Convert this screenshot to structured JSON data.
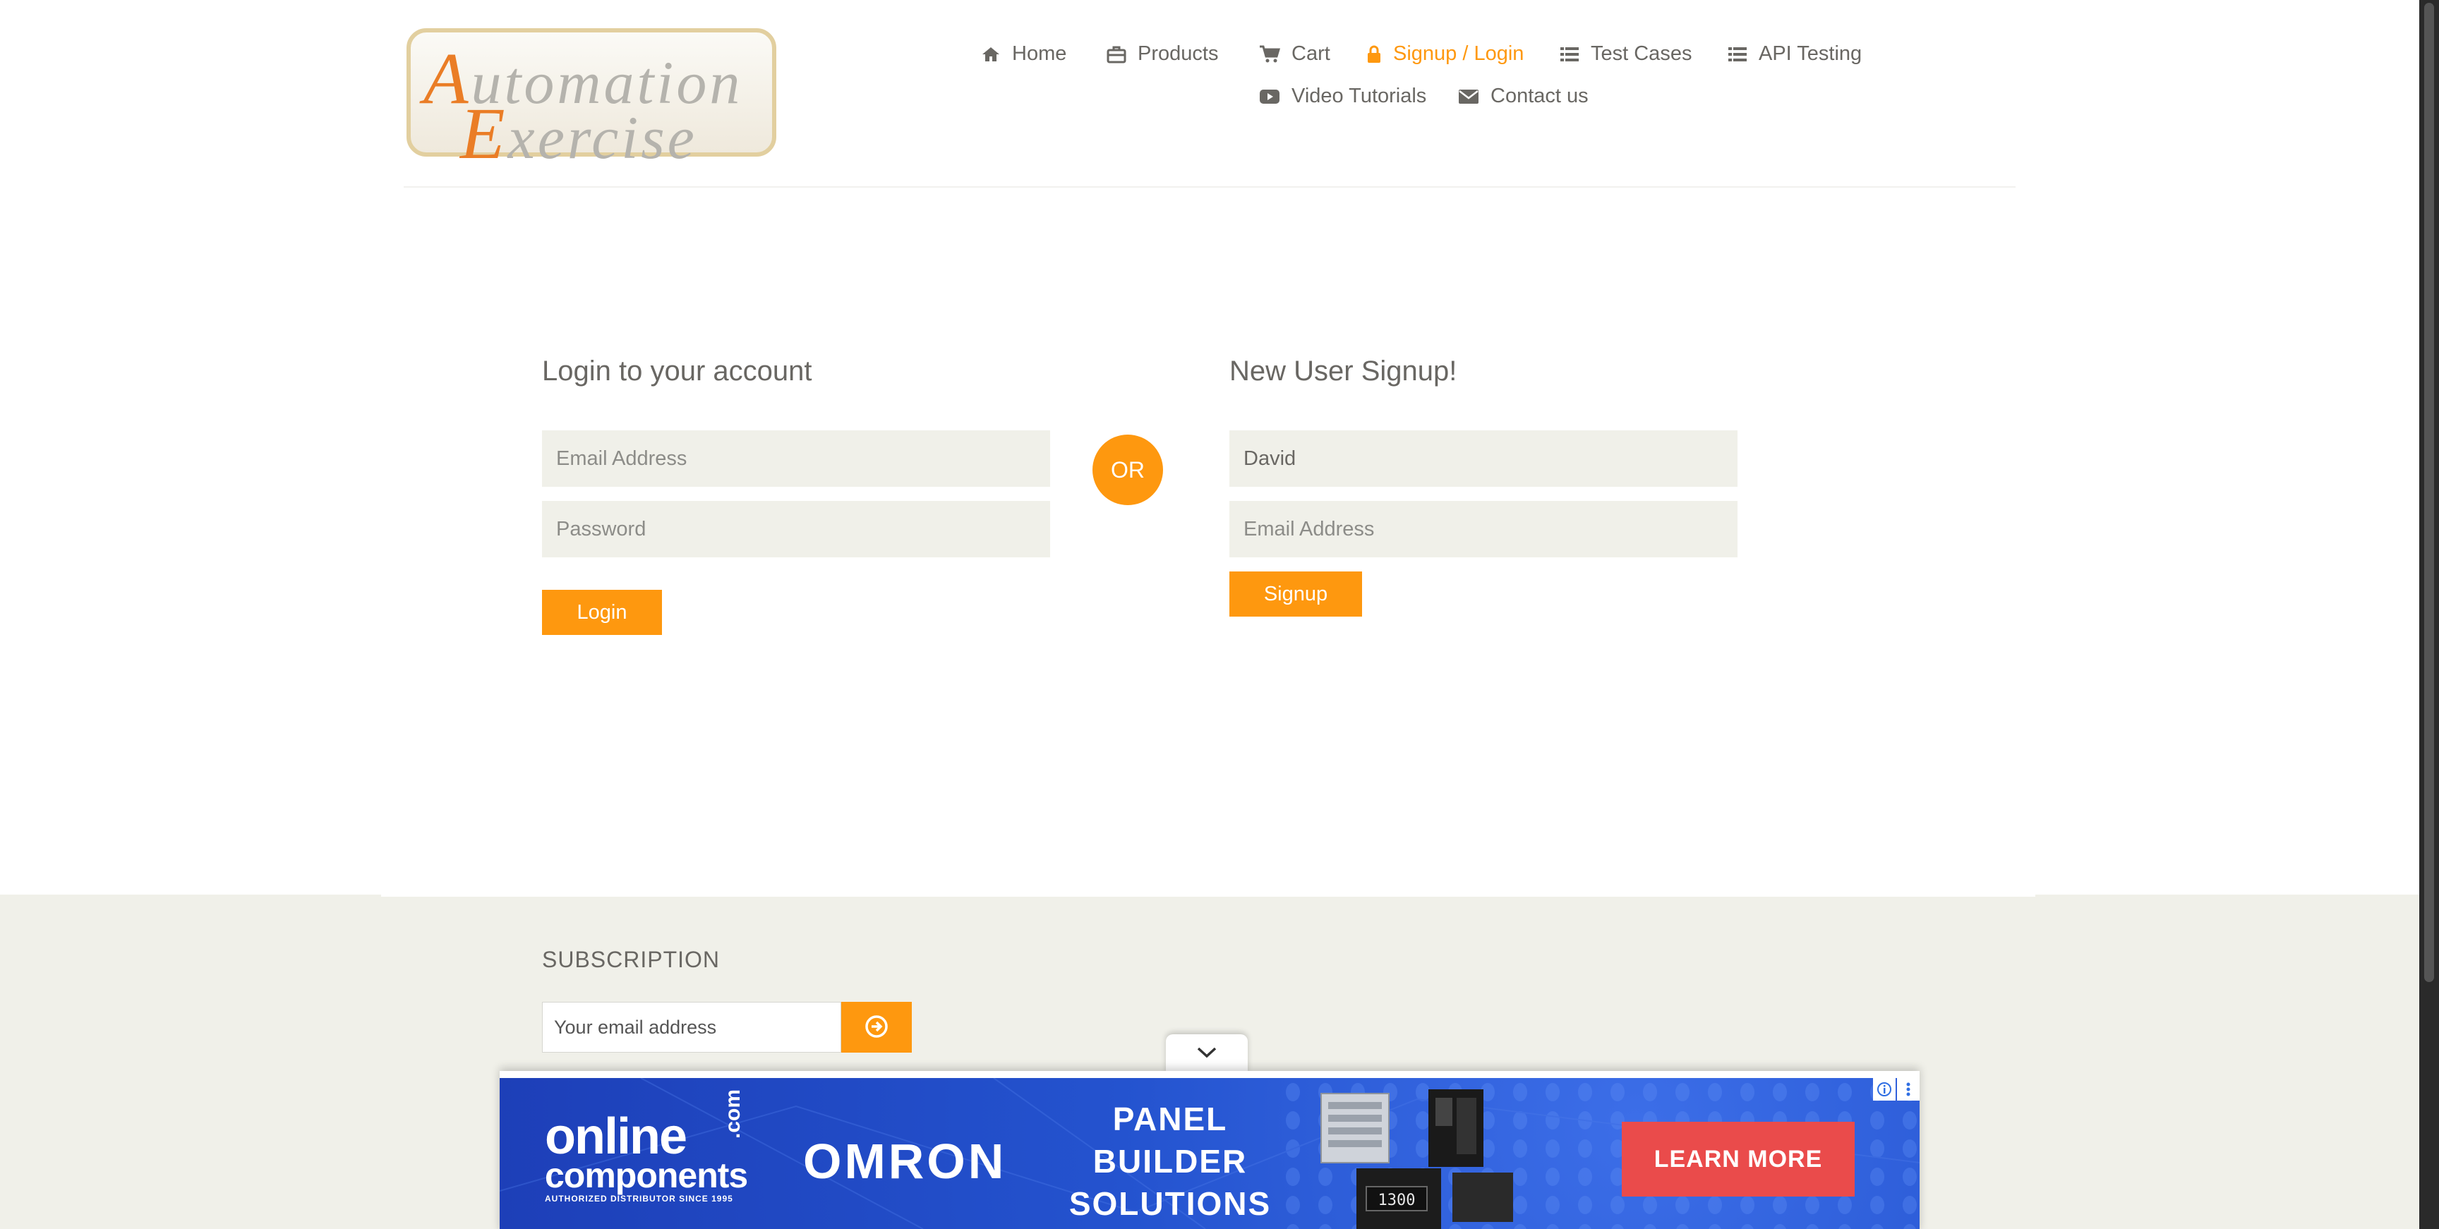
{
  "logo": {
    "line1_cap": "A",
    "line1_rest": "utomation",
    "line2_cap": "E",
    "line2_rest": "xercise"
  },
  "nav": {
    "items": [
      {
        "label": "Home",
        "icon": "home-icon"
      },
      {
        "label": "Products",
        "icon": "briefcase-icon"
      },
      {
        "label": "Cart",
        "icon": "cart-icon"
      },
      {
        "label": "Signup / Login",
        "icon": "lock-icon",
        "active": true
      },
      {
        "label": "Test Cases",
        "icon": "list-icon"
      },
      {
        "label": "API Testing",
        "icon": "list-icon"
      },
      {
        "label": "Video Tutorials",
        "icon": "youtube-icon"
      },
      {
        "label": "Contact us",
        "icon": "envelope-icon"
      }
    ]
  },
  "login": {
    "title": "Login to your account",
    "email_placeholder": "Email Address",
    "password_placeholder": "Password",
    "button": "Login"
  },
  "or_label": "OR",
  "signup": {
    "title": "New User Signup!",
    "name_value": "David",
    "email_placeholder": "Email Address",
    "button": "Signup"
  },
  "subscription": {
    "title": "SUBSCRIPTION",
    "placeholder": "Your email address",
    "button_icon": "arrow-circle-right-icon"
  },
  "ad": {
    "brand1_line1": "online",
    "brand1_line2": "components",
    "brand1_suffix": ".com",
    "brand1_tagline": "AUTHORIZED DISTRIBUTOR SINCE 1995",
    "brand2": "OMRON",
    "headline_1": "PANEL",
    "headline_2": "BUILDER",
    "headline_3": "SOLUTIONS",
    "cta": "LEARN MORE",
    "device_readout": "1300"
  },
  "colors": {
    "accent": "#fe980f",
    "text": "#696763",
    "field_bg": "#f0f0e9",
    "ad_blue": "#2453cf",
    "ad_cta": "#ea4b4b"
  }
}
